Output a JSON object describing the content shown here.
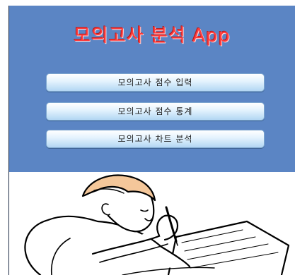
{
  "app": {
    "title": "모의고사 분석 App"
  },
  "menu": {
    "items": [
      {
        "label": "모의고사 점수 입력"
      },
      {
        "label": "모의고사 점수 통계"
      },
      {
        "label": "모의고사 차트 분석"
      }
    ]
  },
  "illustration": {
    "icon": "student-writing-exam-icon"
  },
  "colors": {
    "header_background": "#5b85c4",
    "title_text": "#ff3b3b",
    "button_gradient_top": "#ffffff",
    "button_gradient_bottom": "#b2d6f3",
    "page_background": "#ffffff"
  }
}
